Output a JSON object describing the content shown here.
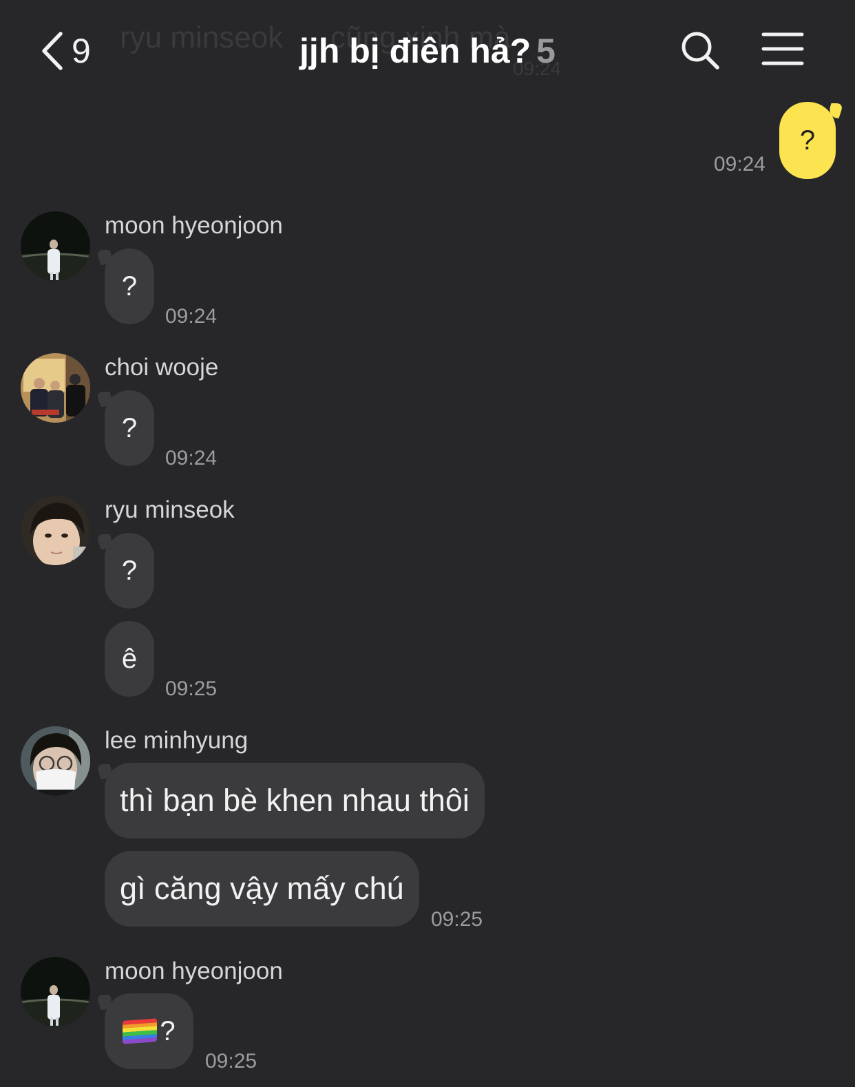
{
  "header": {
    "back_count": "9",
    "title": "jjh bị điên hả?",
    "member_count": "5",
    "ghost_name": "ryu minseok",
    "ghost_text": "cũng xinh mà",
    "ghost_time": "09:24"
  },
  "outgoing": {
    "text": "?",
    "time": "09:24",
    "bubble_color": "#fbe44f"
  },
  "groups": [
    {
      "sender": "moon hyeonjoon",
      "messages": [
        "?"
      ],
      "time": "09:24"
    },
    {
      "sender": "choi wooje",
      "messages": [
        "?"
      ],
      "time": "09:24"
    },
    {
      "sender": "ryu minseok",
      "messages": [
        "?",
        "ê"
      ],
      "time": "09:25"
    },
    {
      "sender": "lee minhyung",
      "messages": [
        "thì bạn bè khen nhau thôi",
        "gì căng vậy mấy chú"
      ],
      "time": "09:25"
    },
    {
      "sender": "moon hyeonjoon",
      "messages": [
        "?"
      ],
      "emoji": "rainbow-flag",
      "time": "09:25"
    }
  ],
  "colors": {
    "background": "#27272a",
    "incoming_bubble": "#3b3b3e",
    "timestamp": "#9c9c9f"
  }
}
